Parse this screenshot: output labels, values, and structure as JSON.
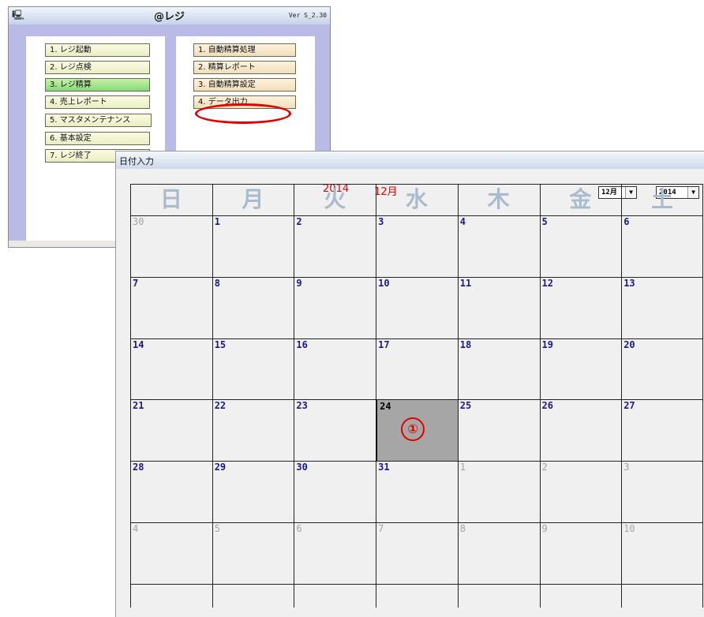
{
  "main_window": {
    "title": "@レジ",
    "version": "Ver S_2.30",
    "left_menu": [
      "1. レジ起動",
      "2. レジ点検",
      "3. レジ精算",
      "4. 売上レポート",
      "5. マスタメンテナンス",
      "6. 基本設定",
      "7. レジ終了"
    ],
    "right_menu": [
      "1. 自動精算処理",
      "2. 精算レポート",
      "3. 自動精算設定",
      "4. データ出力"
    ]
  },
  "calendar_window": {
    "title": "日付入力",
    "year_label": "2014",
    "month_label": "12月",
    "month_select": "12月",
    "year_select": "2014",
    "weekdays": [
      "日",
      "月",
      "火",
      "水",
      "木",
      "金",
      "土"
    ],
    "weeks": [
      [
        {
          "d": "30",
          "o": 1
        },
        {
          "d": "1"
        },
        {
          "d": "2"
        },
        {
          "d": "3"
        },
        {
          "d": "4"
        },
        {
          "d": "5"
        },
        {
          "d": "6"
        }
      ],
      [
        {
          "d": "7"
        },
        {
          "d": "8"
        },
        {
          "d": "9"
        },
        {
          "d": "10"
        },
        {
          "d": "11"
        },
        {
          "d": "12"
        },
        {
          "d": "13"
        }
      ],
      [
        {
          "d": "14"
        },
        {
          "d": "15"
        },
        {
          "d": "16"
        },
        {
          "d": "17"
        },
        {
          "d": "18"
        },
        {
          "d": "19"
        },
        {
          "d": "20"
        }
      ],
      [
        {
          "d": "21"
        },
        {
          "d": "22"
        },
        {
          "d": "23"
        },
        {
          "d": "24",
          "s": 1
        },
        {
          "d": "25"
        },
        {
          "d": "26"
        },
        {
          "d": "27"
        }
      ],
      [
        {
          "d": "28"
        },
        {
          "d": "29"
        },
        {
          "d": "30"
        },
        {
          "d": "31"
        },
        {
          "d": "1",
          "o": 1
        },
        {
          "d": "2",
          "o": 1
        },
        {
          "d": "3",
          "o": 1
        }
      ],
      [
        {
          "d": "4",
          "o": 1
        },
        {
          "d": "5",
          "o": 1
        },
        {
          "d": "6",
          "o": 1
        },
        {
          "d": "7",
          "o": 1
        },
        {
          "d": "8",
          "o": 1
        },
        {
          "d": "9",
          "o": 1
        },
        {
          "d": "10",
          "o": 1
        }
      ]
    ],
    "marker": "①"
  },
  "colors": {
    "accent_red": "#e00000",
    "header_text": "#a8bccd",
    "date_text": "#1a1a8a",
    "main_bg": "#babae6"
  },
  "icons": {
    "system": "computer-icon",
    "dropdown": "chevron-down-icon"
  }
}
